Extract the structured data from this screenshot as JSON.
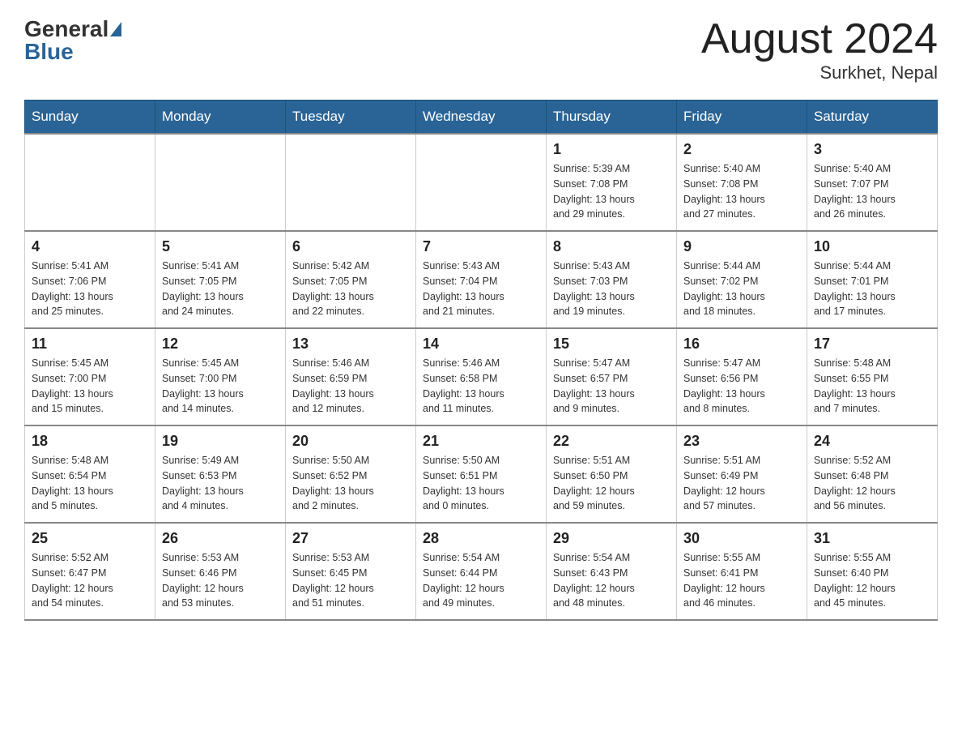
{
  "header": {
    "logo_general": "General",
    "logo_blue": "Blue",
    "month_year": "August 2024",
    "location": "Surkhet, Nepal"
  },
  "days_of_week": [
    "Sunday",
    "Monday",
    "Tuesday",
    "Wednesday",
    "Thursday",
    "Friday",
    "Saturday"
  ],
  "weeks": [
    [
      {
        "day": "",
        "info": ""
      },
      {
        "day": "",
        "info": ""
      },
      {
        "day": "",
        "info": ""
      },
      {
        "day": "",
        "info": ""
      },
      {
        "day": "1",
        "info": "Sunrise: 5:39 AM\nSunset: 7:08 PM\nDaylight: 13 hours\nand 29 minutes."
      },
      {
        "day": "2",
        "info": "Sunrise: 5:40 AM\nSunset: 7:08 PM\nDaylight: 13 hours\nand 27 minutes."
      },
      {
        "day": "3",
        "info": "Sunrise: 5:40 AM\nSunset: 7:07 PM\nDaylight: 13 hours\nand 26 minutes."
      }
    ],
    [
      {
        "day": "4",
        "info": "Sunrise: 5:41 AM\nSunset: 7:06 PM\nDaylight: 13 hours\nand 25 minutes."
      },
      {
        "day": "5",
        "info": "Sunrise: 5:41 AM\nSunset: 7:05 PM\nDaylight: 13 hours\nand 24 minutes."
      },
      {
        "day": "6",
        "info": "Sunrise: 5:42 AM\nSunset: 7:05 PM\nDaylight: 13 hours\nand 22 minutes."
      },
      {
        "day": "7",
        "info": "Sunrise: 5:43 AM\nSunset: 7:04 PM\nDaylight: 13 hours\nand 21 minutes."
      },
      {
        "day": "8",
        "info": "Sunrise: 5:43 AM\nSunset: 7:03 PM\nDaylight: 13 hours\nand 19 minutes."
      },
      {
        "day": "9",
        "info": "Sunrise: 5:44 AM\nSunset: 7:02 PM\nDaylight: 13 hours\nand 18 minutes."
      },
      {
        "day": "10",
        "info": "Sunrise: 5:44 AM\nSunset: 7:01 PM\nDaylight: 13 hours\nand 17 minutes."
      }
    ],
    [
      {
        "day": "11",
        "info": "Sunrise: 5:45 AM\nSunset: 7:00 PM\nDaylight: 13 hours\nand 15 minutes."
      },
      {
        "day": "12",
        "info": "Sunrise: 5:45 AM\nSunset: 7:00 PM\nDaylight: 13 hours\nand 14 minutes."
      },
      {
        "day": "13",
        "info": "Sunrise: 5:46 AM\nSunset: 6:59 PM\nDaylight: 13 hours\nand 12 minutes."
      },
      {
        "day": "14",
        "info": "Sunrise: 5:46 AM\nSunset: 6:58 PM\nDaylight: 13 hours\nand 11 minutes."
      },
      {
        "day": "15",
        "info": "Sunrise: 5:47 AM\nSunset: 6:57 PM\nDaylight: 13 hours\nand 9 minutes."
      },
      {
        "day": "16",
        "info": "Sunrise: 5:47 AM\nSunset: 6:56 PM\nDaylight: 13 hours\nand 8 minutes."
      },
      {
        "day": "17",
        "info": "Sunrise: 5:48 AM\nSunset: 6:55 PM\nDaylight: 13 hours\nand 7 minutes."
      }
    ],
    [
      {
        "day": "18",
        "info": "Sunrise: 5:48 AM\nSunset: 6:54 PM\nDaylight: 13 hours\nand 5 minutes."
      },
      {
        "day": "19",
        "info": "Sunrise: 5:49 AM\nSunset: 6:53 PM\nDaylight: 13 hours\nand 4 minutes."
      },
      {
        "day": "20",
        "info": "Sunrise: 5:50 AM\nSunset: 6:52 PM\nDaylight: 13 hours\nand 2 minutes."
      },
      {
        "day": "21",
        "info": "Sunrise: 5:50 AM\nSunset: 6:51 PM\nDaylight: 13 hours\nand 0 minutes."
      },
      {
        "day": "22",
        "info": "Sunrise: 5:51 AM\nSunset: 6:50 PM\nDaylight: 12 hours\nand 59 minutes."
      },
      {
        "day": "23",
        "info": "Sunrise: 5:51 AM\nSunset: 6:49 PM\nDaylight: 12 hours\nand 57 minutes."
      },
      {
        "day": "24",
        "info": "Sunrise: 5:52 AM\nSunset: 6:48 PM\nDaylight: 12 hours\nand 56 minutes."
      }
    ],
    [
      {
        "day": "25",
        "info": "Sunrise: 5:52 AM\nSunset: 6:47 PM\nDaylight: 12 hours\nand 54 minutes."
      },
      {
        "day": "26",
        "info": "Sunrise: 5:53 AM\nSunset: 6:46 PM\nDaylight: 12 hours\nand 53 minutes."
      },
      {
        "day": "27",
        "info": "Sunrise: 5:53 AM\nSunset: 6:45 PM\nDaylight: 12 hours\nand 51 minutes."
      },
      {
        "day": "28",
        "info": "Sunrise: 5:54 AM\nSunset: 6:44 PM\nDaylight: 12 hours\nand 49 minutes."
      },
      {
        "day": "29",
        "info": "Sunrise: 5:54 AM\nSunset: 6:43 PM\nDaylight: 12 hours\nand 48 minutes."
      },
      {
        "day": "30",
        "info": "Sunrise: 5:55 AM\nSunset: 6:41 PM\nDaylight: 12 hours\nand 46 minutes."
      },
      {
        "day": "31",
        "info": "Sunrise: 5:55 AM\nSunset: 6:40 PM\nDaylight: 12 hours\nand 45 minutes."
      }
    ]
  ]
}
